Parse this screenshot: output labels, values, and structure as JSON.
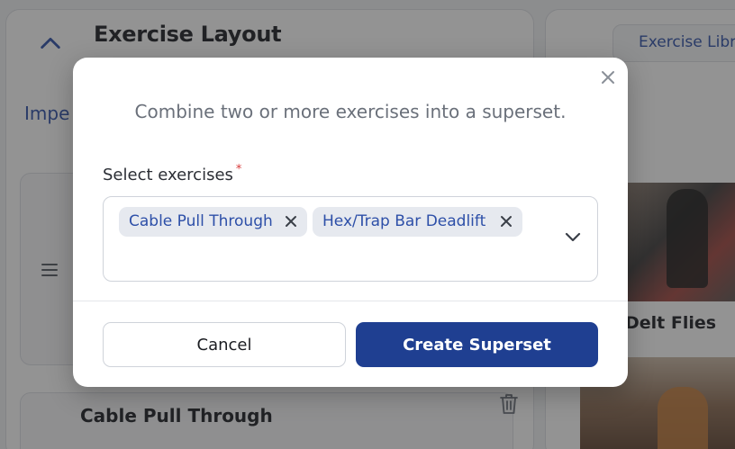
{
  "background": {
    "panel_title": "Exercise Layout",
    "import_link": "Impe",
    "exercise_row_title": "Cable Pull Through",
    "library_tab": "Exercise Libr",
    "library_card_label": "Delt Flies",
    "icons": {
      "collapse": "chevron-up-icon",
      "drag": "drag-handle-icon",
      "trash": "trash-icon"
    }
  },
  "modal": {
    "description": "Combine two or more exercises into a superset.",
    "field_label": "Select exercises",
    "required_mark": "*",
    "selected": [
      {
        "label": "Cable Pull Through"
      },
      {
        "label": "Hex/Trap Bar Deadlift"
      }
    ],
    "cancel_label": "Cancel",
    "create_label": "Create Superset",
    "icons": {
      "close": "close-icon",
      "remove": "x-icon",
      "dropdown": "chevron-down-icon"
    }
  },
  "colors": {
    "accent": "#1f3f91",
    "link": "#2d4fa8",
    "tag_bg": "#e6e9ef",
    "required": "#d83a3a"
  }
}
